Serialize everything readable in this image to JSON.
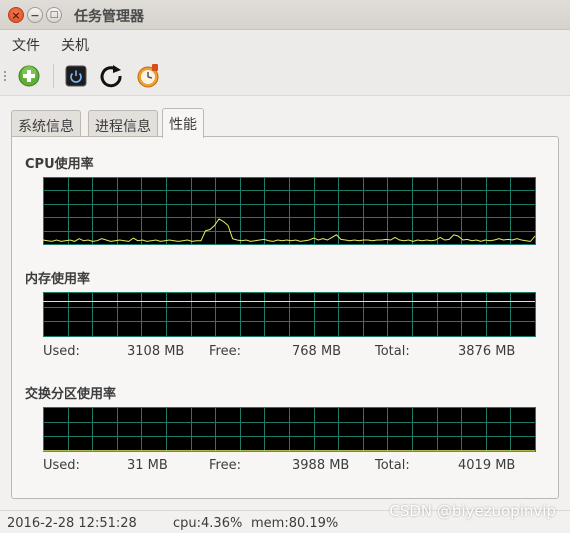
{
  "window": {
    "title": "任务管理器",
    "buttons": {
      "close": "×",
      "minimize": "−",
      "maximize": "□"
    }
  },
  "menubar": {
    "items": [
      "文件",
      "关机"
    ]
  },
  "toolbar": {
    "buttons": [
      {
        "icon": "add-process-icon"
      },
      {
        "icon": "power-icon"
      },
      {
        "icon": "refresh-icon"
      },
      {
        "icon": "clock-icon"
      }
    ]
  },
  "tabs": [
    {
      "label": "系统信息",
      "active": false
    },
    {
      "label": "进程信息",
      "active": false
    },
    {
      "label": "性能",
      "active": true
    }
  ],
  "performance": {
    "cpu": {
      "title": "CPU使用率",
      "line_color": "#e8f060",
      "grid_color": "#1e7a68",
      "values": [
        6,
        5,
        4,
        6,
        4,
        5,
        6,
        4,
        8,
        5,
        6,
        4,
        5,
        8,
        6,
        4,
        5,
        6,
        5,
        4,
        9,
        5,
        6,
        4,
        5,
        6,
        4,
        5,
        6,
        5,
        4,
        5,
        6,
        4,
        5,
        5,
        20,
        22,
        28,
        38,
        34,
        28,
        8,
        6,
        5,
        6,
        4,
        5,
        6,
        7,
        5,
        4,
        6,
        5,
        6,
        5,
        6,
        4,
        5,
        6,
        9,
        6,
        8,
        6,
        10,
        14,
        7,
        6,
        5,
        6,
        5,
        6,
        6,
        5,
        6,
        6,
        7,
        6,
        10,
        6,
        5,
        6,
        4,
        6,
        5,
        6,
        5,
        6,
        10,
        6,
        7,
        14,
        12,
        6,
        7,
        5,
        6,
        4,
        6,
        5,
        6,
        8,
        6,
        7,
        6,
        8,
        6,
        5,
        4,
        12
      ],
      "ylim": [
        0,
        100
      ]
    },
    "memory": {
      "title": "内存使用率",
      "line_color": "#e8f060",
      "percent": 80.19,
      "used_label": "Used:",
      "used": "3108 MB",
      "free_label": "Free:",
      "free": "768 MB",
      "total_label": "Total:",
      "total": "3876 MB"
    },
    "swap": {
      "title": "交换分区使用率",
      "line_color": "#e8f060",
      "percent": 0.77,
      "used_label": "Used:",
      "used": "31 MB",
      "free_label": "Free:",
      "free": "3988 MB",
      "total_label": "Total:",
      "total": "4019 MB"
    }
  },
  "statusbar": {
    "datetime": "2016-2-28 12:51:28",
    "cpu": "cpu:4.36%",
    "mem": "mem:80.19%"
  },
  "watermark": "CSDN @biyezuopinvip"
}
